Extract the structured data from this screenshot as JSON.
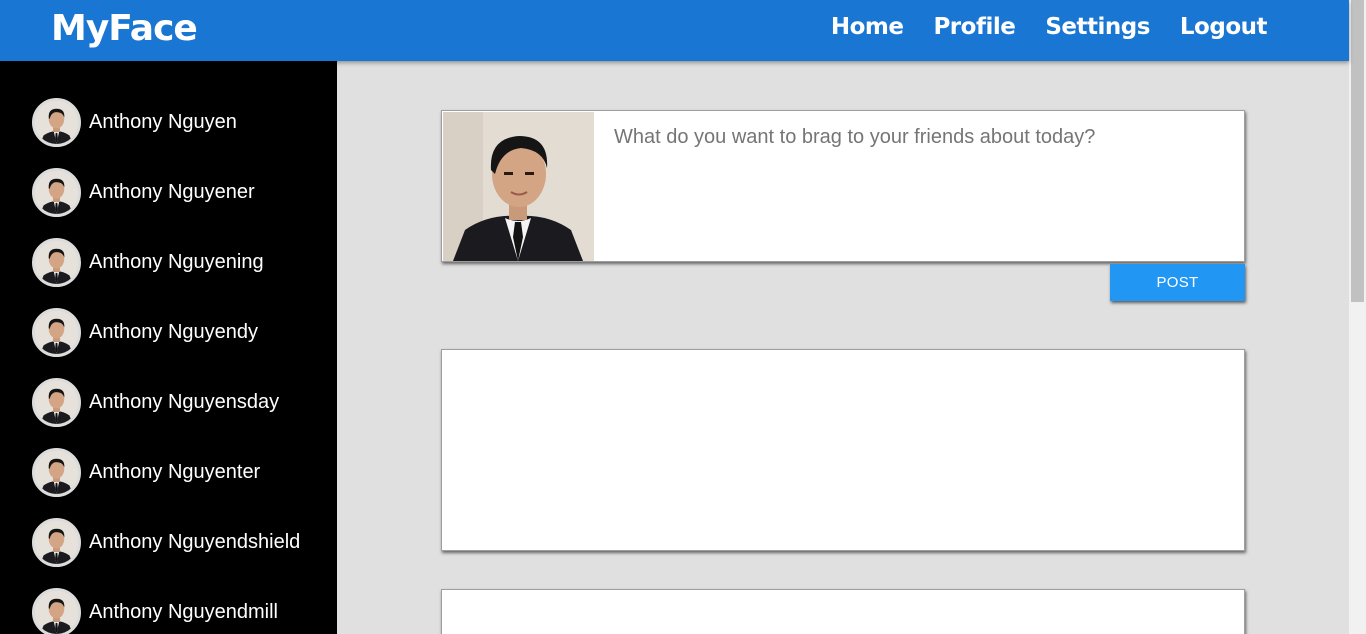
{
  "header": {
    "logo": "MyFace",
    "nav": [
      "Home",
      "Profile",
      "Settings",
      "Logout"
    ]
  },
  "sidebar": {
    "friends": [
      "Anthony Nguyen",
      "Anthony Nguyener",
      "Anthony Nguyening",
      "Anthony Nguyendy",
      "Anthony Nguyensday",
      "Anthony Nguyenter",
      "Anthony Nguyendshield",
      "Anthony Nguyendmill"
    ]
  },
  "composer": {
    "placeholder": "What do you want to brag to your friends about today?",
    "post_label": "POST"
  },
  "colors": {
    "header": "#1976d2",
    "sidebar": "#000000",
    "background": "#e0e0e0",
    "post_button": "#2196f3"
  }
}
